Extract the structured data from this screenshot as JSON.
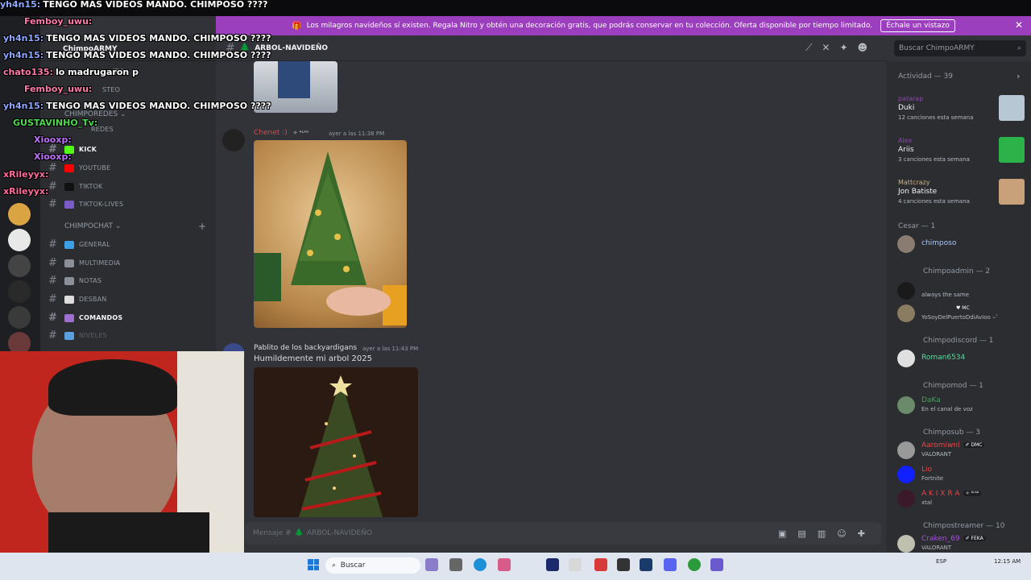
{
  "banner": {
    "text": "Los milagros navideños sí existen. Regala Nitro y obtén una decoración gratis, que podrás conservar en tu colección. Oferta disponible por tiempo limitado.",
    "cta": "Échale un vistazo",
    "close": "✕",
    "gift_icon": "🎁"
  },
  "server": {
    "name": "ChimpoARMY"
  },
  "channels": {
    "categories": [
      {
        "label": "CHIMPOREDES",
        "chevron": "⌄"
      },
      {
        "label": "CHIMPOCHAT",
        "chevron": "⌄"
      }
    ],
    "partial": [
      "IDA",
      "STEO",
      "REDES"
    ],
    "items": [
      {
        "label": "KICK",
        "emoji_color": "#53fc18",
        "active": true
      },
      {
        "label": "YOUTUBE",
        "emoji_color": "#ff0000",
        "active": false
      },
      {
        "label": "TIKTOK",
        "emoji_color": "#111111",
        "active": false
      },
      {
        "label": "TIKTOK-LIVES",
        "emoji_color": "#7a5cc9",
        "active": false
      },
      {
        "label": "GENERAL",
        "emoji_color": "#3ba0e6",
        "active": false
      },
      {
        "label": "MULTIMEDIA",
        "emoji_color": "#8a8f98",
        "active": false
      },
      {
        "label": "NOTAS",
        "emoji_color": "#8a8f98",
        "active": false
      },
      {
        "label": "DESBAN",
        "emoji_color": "#dddddd",
        "active": false
      },
      {
        "label": "COMANDOS",
        "emoji_color": "#a070d0",
        "active": true
      },
      {
        "label": "NIVELES",
        "emoji_color": "#5aa0e0",
        "active": false
      },
      {
        "label": "ARBOL-NAVIDEÑO",
        "emoji_color": "#3ba55c",
        "active": true
      }
    ]
  },
  "chat": {
    "channel_title": "ARBOL-NAVIDEÑO",
    "tree_icon": "🌲",
    "search_placeholder": "Buscar ChimpoARMY",
    "messages": [
      {
        "author": "Chenet :)",
        "author_color": "#c94f4f",
        "badge": "✧ ᴬᴸᴬᴬ",
        "time": "ayer a las 11:38 PM",
        "text": ""
      },
      {
        "author": "Pablito de los backyardigans",
        "author_color": "#dbdee1",
        "badge": "",
        "time": "ayer a las 11:43 PM",
        "text": "Humildemente mi arbol 2025"
      }
    ],
    "composer_placeholder": "Mensaje #",
    "composer_channel": "ARBOL-NAVIDEÑO"
  },
  "activity": {
    "header": "Actividad — 39",
    "cards": [
      {
        "user": "patarap",
        "user_color": "#8e44ad",
        "track": "Duki",
        "sub": "12 canciones esta semana",
        "art": "#b8c7d4"
      },
      {
        "user": "Alex",
        "user_color": "#8e44ad",
        "track": "Ariis",
        "sub": "3 canciones esta semana",
        "art": "#2bb34a"
      },
      {
        "user": "Mattcrazy",
        "user_color": "#c9b48a",
        "track": "Jon Batiste",
        "sub": "4 canciones esta semana",
        "art": "#c8a07a"
      }
    ]
  },
  "roles": [
    {
      "label": "Cesar — 1",
      "members": [
        {
          "name": "chimposo",
          "color": "#a9c8f5",
          "status": "",
          "tag": "",
          "av": "#8a7c70"
        }
      ]
    },
    {
      "label": "Chimpoadmin — 2",
      "members": [
        {
          "name": "",
          "color": "#c94f4f",
          "status": "always the same",
          "tag": "",
          "av": "#1a1a1a"
        },
        {
          "name": "",
          "color": "#c94f4f",
          "status": "YoSoyDelPuertoDdiAvIoo ⌣ʹ",
          "tag": "♥ MC",
          "av": "#8a7c60"
        }
      ]
    },
    {
      "label": "Chimpodiscord — 1",
      "members": [
        {
          "name": "Roman6534",
          "color": "#5dd8a0",
          "status": "",
          "tag": "",
          "av": "#e0e0e0"
        }
      ]
    },
    {
      "label": "Chimpomod — 1",
      "members": [
        {
          "name": "DaKa",
          "color": "#3ba55c",
          "status": "En el canal de voz",
          "tag": "",
          "av": "#6a8a6a"
        }
      ]
    },
    {
      "label": "Chimposub — 3",
      "members": [
        {
          "name": "Aaromiwnl",
          "color": "#e84545",
          "status": "VALORANT",
          "tag": "✐ DMC",
          "av": "#999999"
        },
        {
          "name": "Lio",
          "color": "#e84545",
          "status": "Fortnite",
          "tag": "",
          "av": "#1020ff"
        },
        {
          "name": "A K I X R A",
          "color": "#e84545",
          "status": "xtal",
          "tag": "✧ ᴬᴸᴬᴬ",
          "av": "#3a1a2a"
        }
      ]
    },
    {
      "label": "Chimpostreamer — 10",
      "members": [
        {
          "name": "Craken_69",
          "color": "#a64ee0",
          "status": "VALORANT",
          "tag": "✐ FEKA",
          "av": "#c0c0b0"
        }
      ]
    }
  ],
  "overlay_chat": [
    {
      "user": "yh4n15:",
      "color": "#8fa8ff",
      "msg": "TENGO MAS VIDEOS MANDO. CHIMPOSO ????"
    },
    {
      "user": "Femboy_uwu:",
      "color": "#ff7aa8",
      "msg": ""
    },
    {
      "user": "yh4n15:",
      "color": "#8fa8ff",
      "msg": "TENGO MAS VIDEOS MANDO. CHIMPOSO ????"
    },
    {
      "user": "yh4n15:",
      "color": "#8fa8ff",
      "msg": "TENGO MAS VIDEOS MANDO. CHIMPOSO ????"
    },
    {
      "user": "chato135:",
      "color": "#ff7aa8",
      "msg": "lo madrugaron p"
    },
    {
      "user": "Femboy_uwu:",
      "color": "#ff7aa8",
      "msg": ""
    },
    {
      "user": "yh4n15:",
      "color": "#8fa8ff",
      "msg": "TENGO MAS VIDEOS MANDO. CHIMPOSO ????"
    },
    {
      "user": "GUSTAVINHO_Tv:",
      "color": "#4dd94d",
      "msg": ""
    },
    {
      "user": "Xiooxp:",
      "color": "#c070ff",
      "msg": ""
    },
    {
      "user": "Xiooxp:",
      "color": "#c070ff",
      "msg": ""
    },
    {
      "user": "xRileyyx:",
      "color": "#ff6b9a",
      "msg": ""
    },
    {
      "user": "xRileyyx:",
      "color": "#ff6b9a",
      "msg": ""
    }
  ],
  "taskbar": {
    "search": "Buscar",
    "lang": "ESP",
    "time": "12:15 AM",
    "app_colors": [
      "#8a7cc8",
      "#666666",
      "#1e90d8",
      "#d85c8a",
      "#1a2a6a",
      "#d8d8d8",
      "#d83a3a",
      "#333333",
      "#1a3a6a",
      "#5865f2",
      "#2a9a3a",
      "#6a5acd"
    ]
  }
}
